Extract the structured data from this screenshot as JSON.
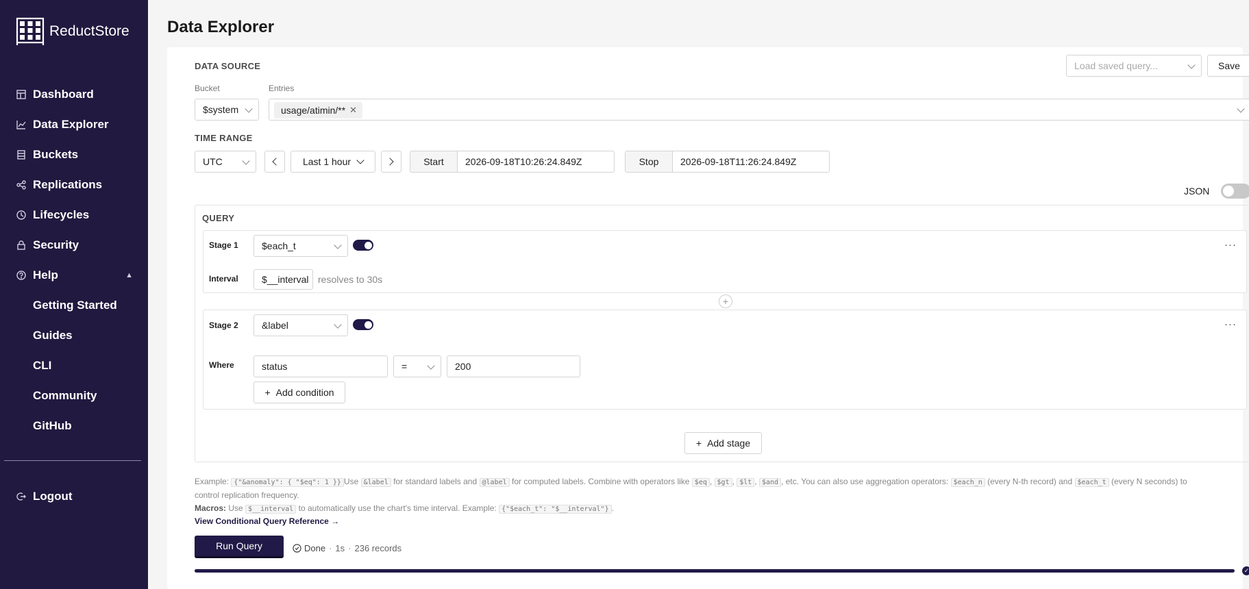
{
  "app": {
    "name": "ReductStore"
  },
  "sidebar": {
    "items": [
      {
        "label": "Dashboard",
        "icon": "dashboard-icon"
      },
      {
        "label": "Data Explorer",
        "icon": "line-chart-icon"
      },
      {
        "label": "Buckets",
        "icon": "bucket-icon"
      },
      {
        "label": "Replications",
        "icon": "share-icon"
      },
      {
        "label": "Lifecycles",
        "icon": "clock-icon"
      },
      {
        "label": "Security",
        "icon": "lock-icon"
      },
      {
        "label": "Help",
        "icon": "help-circle-icon"
      }
    ],
    "help_items": [
      {
        "label": "Getting Started"
      },
      {
        "label": "Guides"
      },
      {
        "label": "CLI"
      },
      {
        "label": "Community"
      },
      {
        "label": "GitHub"
      }
    ],
    "logout": "Logout"
  },
  "page": {
    "title": "Data Explorer"
  },
  "data_source": {
    "heading": "DATA SOURCE",
    "saved_query_placeholder": "Load saved query...",
    "save_label": "Save",
    "bucket_label": "Bucket",
    "bucket_value": "$system",
    "entries_label": "Entries",
    "entries": [
      "usage/atimin/**"
    ]
  },
  "time_range": {
    "heading": "TIME RANGE",
    "timezone": "UTC",
    "preset": "Last 1 hour",
    "start_label": "Start",
    "start_value": "2026-09-18T10:26:24.849Z",
    "stop_label": "Stop",
    "stop_value": "2026-09-18T11:26:24.849Z"
  },
  "json_toggle": {
    "label": "JSON",
    "enabled": false
  },
  "query": {
    "heading": "QUERY",
    "stages": [
      {
        "label": "Stage 1",
        "operator": "$each_t",
        "enabled": true,
        "param_label": "Interval",
        "param_value": "$__interval",
        "hint": "resolves to 30s"
      },
      {
        "label": "Stage 2",
        "operator": "&label",
        "enabled": true,
        "param_label": "Where",
        "condition": {
          "field": "status",
          "op": "=",
          "value": "200"
        },
        "add_condition_label": "Add condition"
      }
    ],
    "add_stage_label": "Add stage"
  },
  "help": {
    "example_prefix": "Example:",
    "example_code": "{\"&anomaly\": { \"$eq\": 1 }}",
    "t1": "Use",
    "code_label": "&label",
    "t2": "for standard labels and",
    "code_computed": "@label",
    "t3": "for computed labels. Combine with operators like",
    "code_eq": "$eq",
    "code_gt": "$gt",
    "code_lt": "$lt",
    "code_and": "$and",
    "t4": ", etc. You can also use aggregation operators:",
    "code_each_n": "$each_n",
    "t5": "(every N-th record) and",
    "code_each_t": "$each_t",
    "t6": "(every N seconds) to",
    "t7": "control replication frequency.",
    "macros_label": "Macros:",
    "m1": "Use",
    "code_interval": "$__interval",
    "m2": "to automatically use the chart's time interval. Example:",
    "code_macro_example": "{\"$each_t\": \"$__interval\"}",
    "reference_link": "View Conditional Query Reference →"
  },
  "run": {
    "label": "Run Query",
    "status": "Done",
    "duration": "1s",
    "records": "236 records",
    "progress": 1.0
  }
}
